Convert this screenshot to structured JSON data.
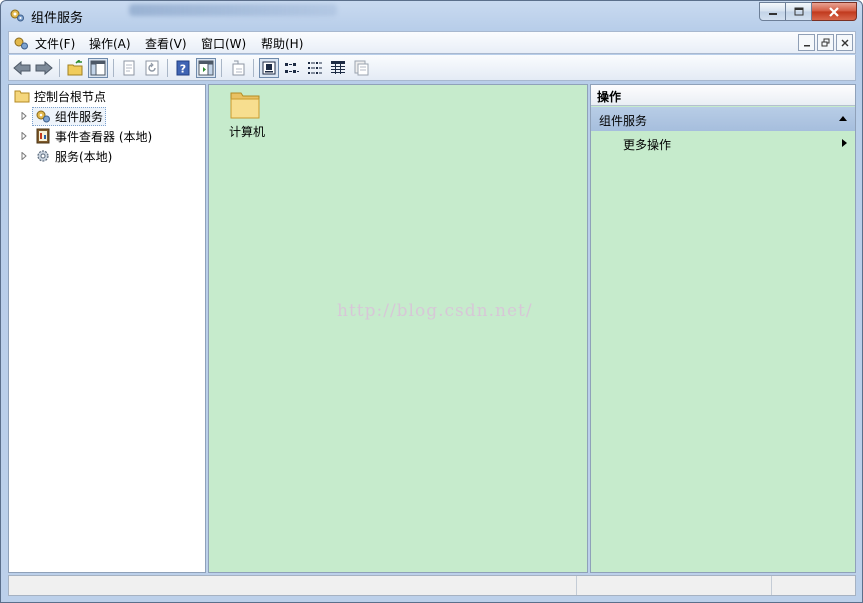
{
  "window": {
    "title": "组件服务",
    "icon": "component-services-icon"
  },
  "menubar": {
    "items": [
      {
        "label": "文件(F)"
      },
      {
        "label": "操作(A)"
      },
      {
        "label": "查看(V)"
      },
      {
        "label": "窗口(W)"
      },
      {
        "label": "帮助(H)"
      }
    ]
  },
  "toolbar": {
    "buttons": [
      "back-icon",
      "forward-icon",
      "up-folder-icon",
      "show-tree-icon",
      "properties-icon",
      "refresh-icon",
      "help-icon",
      "action-pane-icon",
      "export-icon",
      "large-icons-view-icon",
      "small-icons-view-icon",
      "list-view-icon",
      "details-view-icon",
      "config-icon"
    ]
  },
  "tree": {
    "root": {
      "label": "控制台根节点"
    },
    "items": [
      {
        "label": "组件服务",
        "selected": true
      },
      {
        "label": "事件查看器 (本地)"
      },
      {
        "label": "服务(本地)"
      }
    ]
  },
  "center": {
    "items": [
      {
        "label": "计算机"
      }
    ],
    "watermark": "http://blog.csdn.net/",
    "background": "#c6ebcc"
  },
  "actions": {
    "header": "操作",
    "group": "组件服务",
    "items": [
      {
        "label": "更多操作"
      }
    ]
  },
  "colors": {
    "pane_green": "#c6ebcc",
    "group_header": "#a6bedd"
  }
}
